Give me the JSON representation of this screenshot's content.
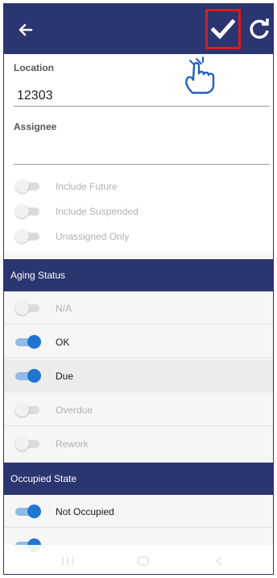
{
  "header": {
    "back_icon": "arrow-left-icon",
    "confirm_icon": "checkmark-icon",
    "refresh_icon": "refresh-icon",
    "highlight_color": "#e01a1a",
    "bar_color": "#2b3570"
  },
  "form": {
    "location_label": "Location",
    "location_value": "12303",
    "assignee_label": "Assignee",
    "assignee_value": ""
  },
  "filters": [
    {
      "label": "Include Future",
      "on": false
    },
    {
      "label": "Include Suspended",
      "on": false
    },
    {
      "label": "Unassigned Only",
      "on": false
    }
  ],
  "aging_status": {
    "title": "Aging Status",
    "items": [
      {
        "label": "N/A",
        "on": false
      },
      {
        "label": "OK",
        "on": true
      },
      {
        "label": "Due",
        "on": true
      },
      {
        "label": "Overdue",
        "on": false
      },
      {
        "label": "Rework",
        "on": false
      }
    ]
  },
  "occupied_state": {
    "title": "Occupied State",
    "items": [
      {
        "label": "Not Occupied",
        "on": true
      },
      {
        "label": "",
        "on": true
      }
    ]
  },
  "toggle_color": "#1f76d2"
}
